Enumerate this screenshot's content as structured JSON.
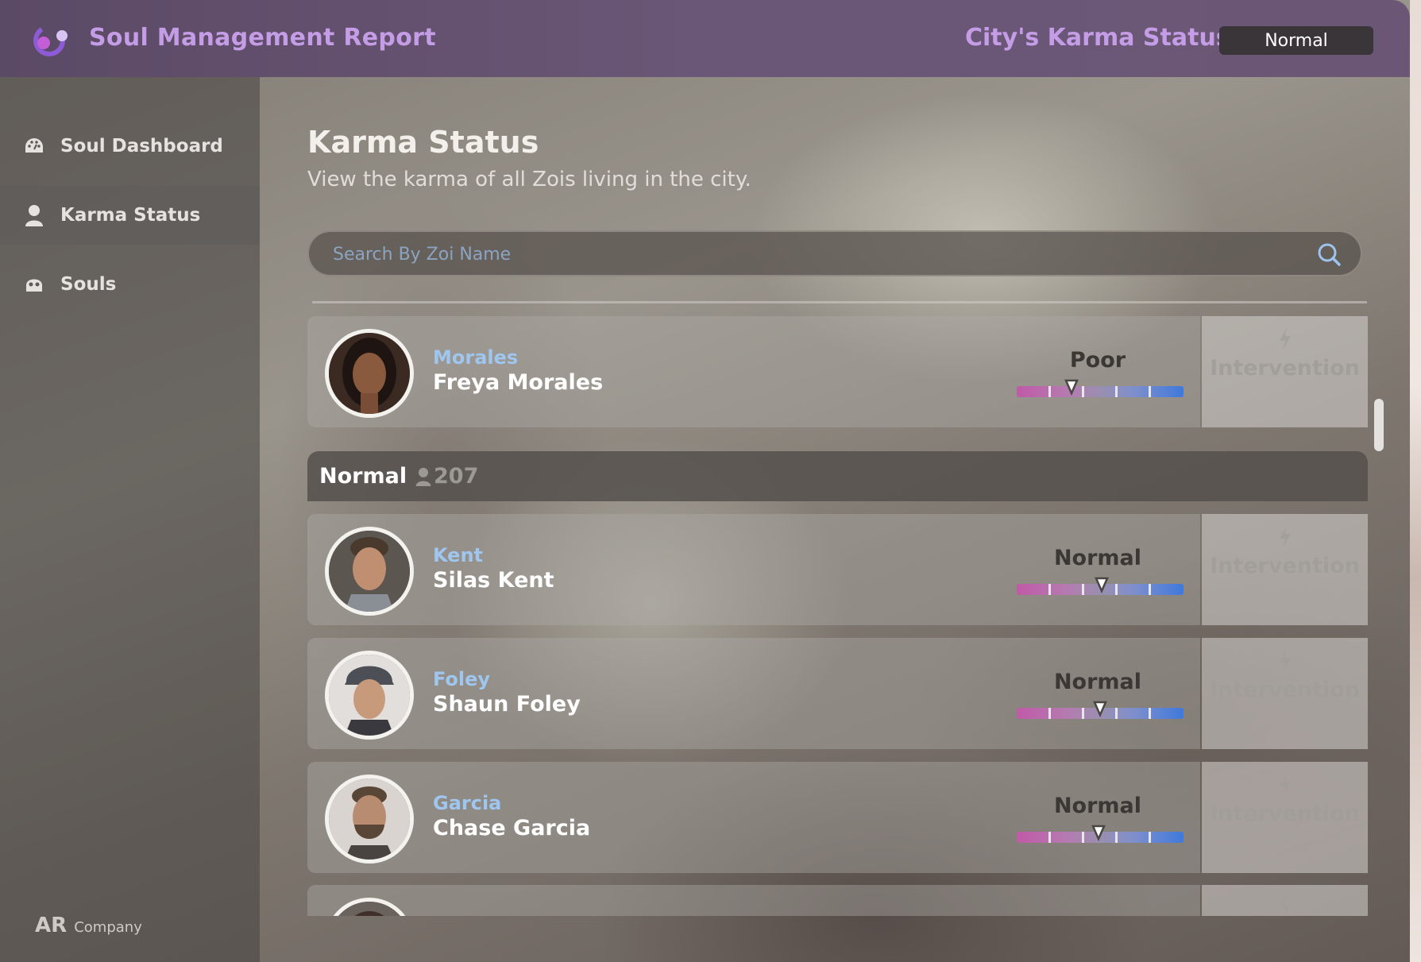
{
  "app": {
    "title": "Soul Management Report",
    "karma_label": "City's Karma Status:",
    "karma_value": "Normal"
  },
  "sidebar": {
    "items": [
      {
        "label": "Soul Dashboard",
        "icon": "dashboard-icon",
        "active": false
      },
      {
        "label": "Karma Status",
        "icon": "person-icon",
        "active": true
      },
      {
        "label": "Souls",
        "icon": "soul-icon",
        "active": false
      }
    ],
    "brand_main": "AR",
    "brand_sub": "Company"
  },
  "main": {
    "title": "Karma Status",
    "subtitle": "View the karma of all Zois living in the city.",
    "search_placeholder": "Search By Zoi Name"
  },
  "groups": [
    {
      "label": "Normal",
      "count": "207"
    }
  ],
  "rows": [
    {
      "surname": "Morales",
      "name": "Freya Morales",
      "status": "Poor",
      "karma_fraction": 0.33,
      "action": "Intervention"
    },
    {
      "surname": "Kent",
      "name": "Silas Kent",
      "status": "Normal",
      "karma_fraction": 0.51,
      "action": "Intervention"
    },
    {
      "surname": "Foley",
      "name": "Shaun Foley",
      "status": "Normal",
      "karma_fraction": 0.5,
      "action": "Intervention"
    },
    {
      "surname": "Garcia",
      "name": "Chase Garcia",
      "status": "Normal",
      "karma_fraction": 0.49,
      "action": "Intervention"
    }
  ],
  "colors": {
    "accent": "#c59ce6",
    "surname": "#9fc6ee",
    "karma_low": "#c05aa8",
    "karma_high": "#3f79dc"
  }
}
